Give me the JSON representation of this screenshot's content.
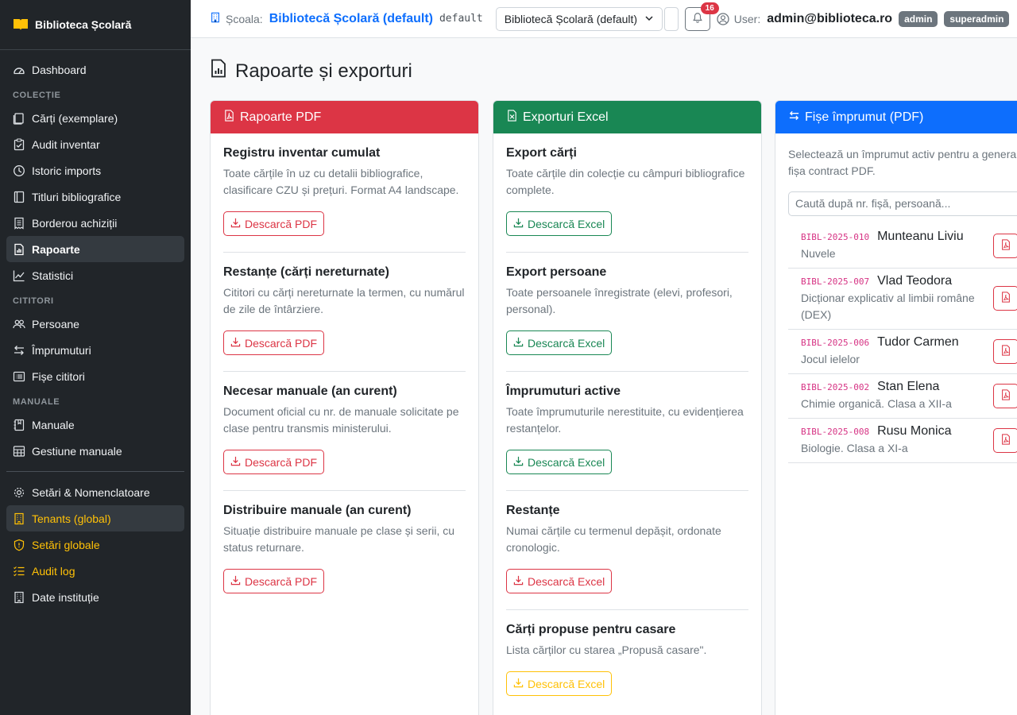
{
  "app": {
    "brand": "Biblioteca Școlară"
  },
  "sidebar": {
    "items": [
      {
        "label": "Dashboard"
      },
      {
        "section": "COLECȚIE"
      },
      {
        "label": "Cărți (exemplare)"
      },
      {
        "label": "Audit inventar"
      },
      {
        "label": "Istoric imports"
      },
      {
        "label": "Titluri bibliografice"
      },
      {
        "label": "Borderou achiziții"
      },
      {
        "label": "Rapoarte",
        "active": true
      },
      {
        "label": "Statistici"
      },
      {
        "section": "CITITORI"
      },
      {
        "label": "Persoane"
      },
      {
        "label": "Împrumuturi"
      },
      {
        "label": "Fișe cititori"
      },
      {
        "section": "MANUALE"
      },
      {
        "label": "Manuale"
      },
      {
        "label": "Gestiune manuale"
      },
      {
        "label": "Setări & Nomenclatoare"
      },
      {
        "label": "Tenants (global)"
      },
      {
        "label": "Setări globale"
      },
      {
        "label": "Audit log"
      },
      {
        "label": "Date instituție"
      }
    ]
  },
  "topbar": {
    "school_label": "Școala:",
    "school_name": "Bibliotecă Școlară (default)",
    "school_code": "default",
    "school_select": "Bibliotecă Școlară (default)",
    "notifications": "16",
    "user_label": "User:",
    "user_email": "admin@biblioteca.ro",
    "roles": [
      "admin",
      "superadmin"
    ]
  },
  "page": {
    "title": "Rapoarte și exporturi"
  },
  "pdf_card": {
    "header": "Rapoarte PDF",
    "color": "#dc3545",
    "items": [
      {
        "title": "Registru inventar cumulat",
        "desc": "Toate cărțile în uz cu detalii bibliografice, clasificare CZU și prețuri. Format A4 landscape.",
        "button": "Descarcă PDF"
      },
      {
        "title": "Restanțe (cărți nereturnate)",
        "desc": "Cititori cu cărți nereturnate la termen, cu numărul de zile de întârziere.",
        "button": "Descarcă PDF"
      },
      {
        "title": "Necesar manuale (an curent)",
        "desc": "Document oficial cu nr. de manuale solicitate pe clase pentru transmis ministerului.",
        "button": "Descarcă PDF"
      },
      {
        "title": "Distribuire manuale (an curent)",
        "desc": "Situație distribuire manuale pe clase și serii, cu status returnare.",
        "button": "Descarcă PDF"
      }
    ]
  },
  "excel_card": {
    "header": "Exporturi Excel",
    "color": "#198754",
    "items": [
      {
        "title": "Export cărți",
        "desc": "Toate cărțile din colecție cu câmpuri bibliografice complete.",
        "button": "Descarcă Excel"
      },
      {
        "title": "Export persoane",
        "desc": "Toate persoanele înregistrate (elevi, profesori, personal).",
        "button": "Descarcă Excel"
      },
      {
        "title": "Împrumuturi active",
        "desc": "Toate împrumuturile nerestituite, cu evidențierea restanțelor.",
        "button": "Descarcă Excel"
      },
      {
        "title": "Restanțe",
        "desc": "Numai cărțile cu termenul depășit, ordonate cronologic.",
        "button": "Descarcă Excel"
      },
      {
        "title": "Cărți propuse pentru casare",
        "desc": "Lista cărților cu starea „Propusă casare\".",
        "button": "Descarcă Excel"
      }
    ]
  },
  "loans_card": {
    "header": "Fișe împrumut (PDF)",
    "color": "#0d6efd",
    "intro_line1": "Selectează un împrumut activ pentru a genera",
    "intro_line2": "fișa contract PDF.",
    "search_placeholder": "Caută după nr. fișă, persoană...",
    "loans": [
      {
        "code": "BIBL-2025-010",
        "name": "Munteanu Liviu",
        "title": "Nuvele"
      },
      {
        "code": "BIBL-2025-007",
        "name": "Vlad Teodora",
        "title": "Dicționar explicativ al limbii române (DEX)"
      },
      {
        "code": "BIBL-2025-006",
        "name": "Tudor Carmen",
        "title": "Jocul ielelor"
      },
      {
        "code": "BIBL-2025-002",
        "name": "Stan Elena",
        "title": "Chimie organică. Clasa a XII-a"
      },
      {
        "code": "BIBL-2025-008",
        "name": "Rusu Monica",
        "title": "Biologie. Clasa a XI-a"
      }
    ]
  }
}
